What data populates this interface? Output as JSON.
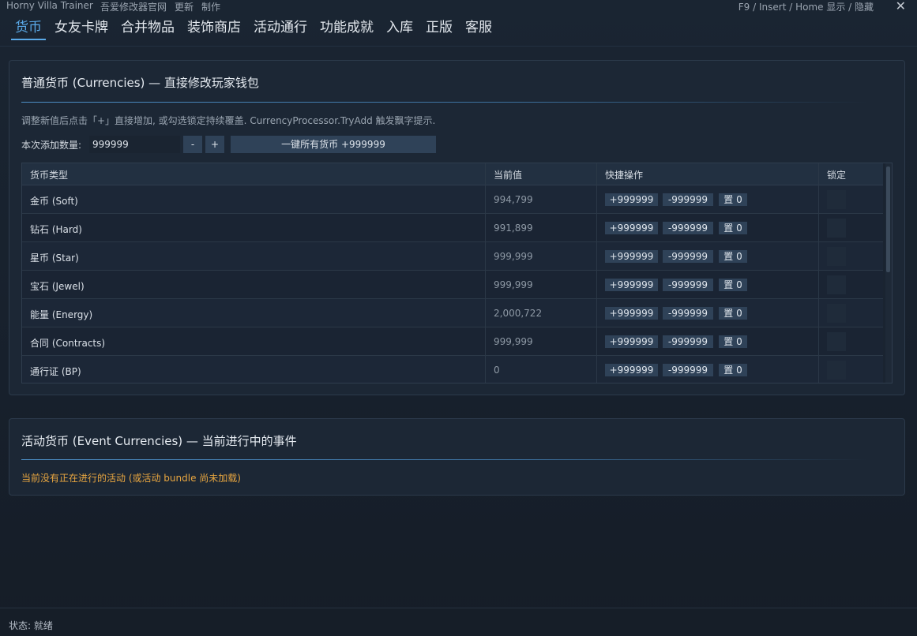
{
  "window": {
    "app_title": "Horny Villa Trainer",
    "links": [
      "吾爱修改器官网",
      "更新",
      "制作"
    ],
    "hotkey_hint": "F9 / Insert / Home  显示 / 隐藏",
    "close_glyph": "✕"
  },
  "nav": {
    "tabs": [
      "货币",
      "女友卡牌",
      "合并物品",
      "装饰商店",
      "活动通行",
      "功能成就",
      "入库",
      "正版",
      "客服"
    ],
    "active_index": 0
  },
  "currencies": {
    "title": "普通货币 (Currencies) — 直接修改玩家钱包",
    "hint": "调整新值后点击「+」直接增加, 或勾选锁定持续覆盖. CurrencyProcessor.TryAdd 触发飘字提示.",
    "qty_label": "本次添加数量:",
    "qty_value": "999999",
    "minus_label": "-",
    "plus_label": "+",
    "add_all_label": "一键所有货币 +999999",
    "columns": [
      "货币类型",
      "当前值",
      "快捷操作",
      "锁定"
    ],
    "actions": [
      "+999999",
      "-999999",
      "置 0"
    ],
    "rows": [
      {
        "name": "金币 (Soft)",
        "value": "994,799"
      },
      {
        "name": "钻石 (Hard)",
        "value": "991,899"
      },
      {
        "name": "星币 (Star)",
        "value": "999,999"
      },
      {
        "name": "宝石 (Jewel)",
        "value": "999,999"
      },
      {
        "name": "能量 (Energy)",
        "value": "2,000,722"
      },
      {
        "name": "合同 (Contracts)",
        "value": "999,999"
      },
      {
        "name": "通行证 (BP)",
        "value": "0"
      }
    ]
  },
  "events": {
    "title": "活动货币 (Event Currencies) — 当前进行中的事件",
    "empty_message": "当前没有正在进行的活动 (或活动 bundle 尚未加载)"
  },
  "status": {
    "text": "状态: 就绪"
  },
  "colors": {
    "accent": "#5aa9e8",
    "warning": "#e8a640",
    "button": "#2f4258"
  }
}
